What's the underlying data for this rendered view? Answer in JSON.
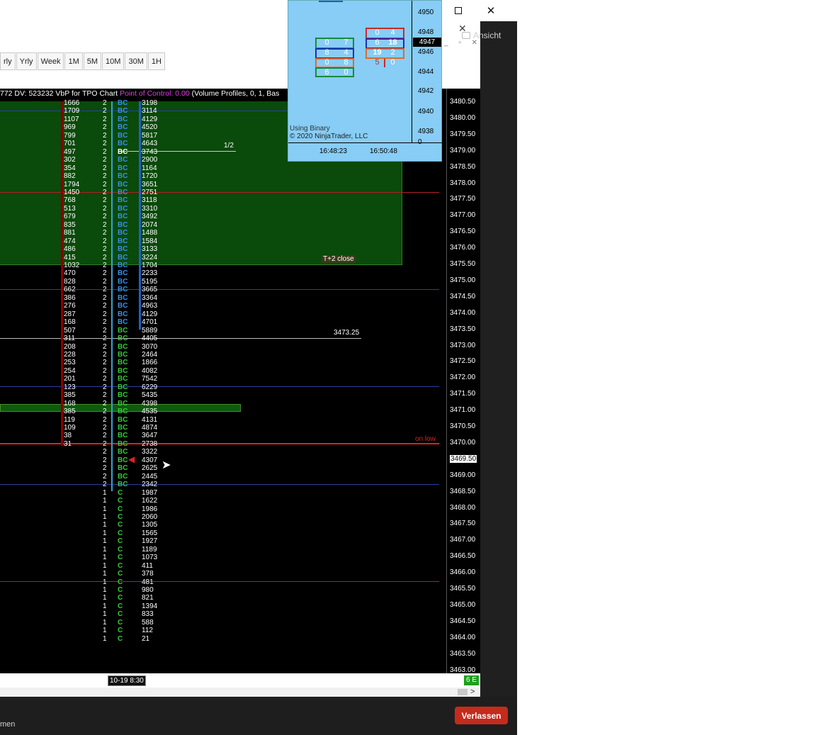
{
  "window": {
    "inner_close": "✕",
    "view_button": "Ansicht",
    "leave_button": "Verlassen",
    "meeting_text": "men"
  },
  "toolbar": {
    "timeframes": [
      "rly",
      "Yrly",
      "Week",
      "1M",
      "5M",
      "10M",
      "30M",
      "1H"
    ]
  },
  "chart": {
    "header_main": "772 DV: 523232 VbP for TPO Chart",
    "header_poc": "Point of Control: 0.00",
    "header_rest": "(Volume Profiles, 0, 1, Bas",
    "price_axis": [
      "3480.50",
      "3480.00",
      "3479.50",
      "3479.00",
      "3478.50",
      "3478.00",
      "3477.50",
      "3477.00",
      "3476.50",
      "3476.00",
      "3475.50",
      "3475.00",
      "3474.50",
      "3474.00",
      "3473.50",
      "3473.00",
      "3472.50",
      "3472.00",
      "3471.50",
      "3471.00",
      "3470.50",
      "3470.00",
      "3469.50",
      "3469.00",
      "3468.50",
      "3468.00",
      "3467.50",
      "3467.00",
      "3466.50",
      "3466.00",
      "3465.50",
      "3465.00",
      "3464.50",
      "3464.00",
      "3463.50",
      "3463.00"
    ],
    "current_price": "3469.50",
    "annotations": {
      "half": "1/2",
      "t2_close": "T+2 close",
      "level_3473": "3473.25",
      "on_low": "on low"
    },
    "date_label": "10-19  8:30",
    "status": "6 E",
    "rows": [
      {
        "vol": "1666",
        "cnt": "2",
        "let": "BC",
        "val": "3198",
        "color": "#3a8ee6"
      },
      {
        "vol": "1709",
        "cnt": "2",
        "let": "BC",
        "val": "3114",
        "color": "#3a8ee6"
      },
      {
        "vol": "1107",
        "cnt": "2",
        "let": "BC",
        "val": "4129",
        "color": "#3a8ee6"
      },
      {
        "vol": "969",
        "cnt": "2",
        "let": "BC",
        "val": "4520",
        "color": "#3a8ee6"
      },
      {
        "vol": "799",
        "cnt": "2",
        "let": "BC",
        "val": "5817",
        "color": "#3a8ee6"
      },
      {
        "vol": "701",
        "cnt": "2",
        "let": "BC",
        "val": "4643",
        "color": "#3a8ee6"
      },
      {
        "vol": "497",
        "cnt": "2",
        "let": "BC",
        "val": "3743",
        "color": "#ffffff"
      },
      {
        "vol": "302",
        "cnt": "2",
        "let": "BC",
        "val": "2900",
        "color": "#3a8ee6"
      },
      {
        "vol": "354",
        "cnt": "2",
        "let": "BC",
        "val": "1164",
        "color": "#3a8ee6"
      },
      {
        "vol": "882",
        "cnt": "2",
        "let": "BC",
        "val": "1720",
        "color": "#3a8ee6"
      },
      {
        "vol": "1794",
        "cnt": "2",
        "let": "BC",
        "val": "3651",
        "color": "#3a8ee6"
      },
      {
        "vol": "1450",
        "cnt": "2",
        "let": "BC",
        "val": "2751",
        "color": "#3a8ee6"
      },
      {
        "vol": "768",
        "cnt": "2",
        "let": "BC",
        "val": "3118",
        "color": "#3a8ee6"
      },
      {
        "vol": "513",
        "cnt": "2",
        "let": "BC",
        "val": "3310",
        "color": "#3a8ee6"
      },
      {
        "vol": "679",
        "cnt": "2",
        "let": "BC",
        "val": "3492",
        "color": "#3a8ee6"
      },
      {
        "vol": "835",
        "cnt": "2",
        "let": "BC",
        "val": "2074",
        "color": "#3a8ee6"
      },
      {
        "vol": "881",
        "cnt": "2",
        "let": "BC",
        "val": "1488",
        "color": "#3a8ee6"
      },
      {
        "vol": "474",
        "cnt": "2",
        "let": "BC",
        "val": "1584",
        "color": "#3a8ee6"
      },
      {
        "vol": "486",
        "cnt": "2",
        "let": "BC",
        "val": "3133",
        "color": "#3a8ee6"
      },
      {
        "vol": "415",
        "cnt": "2",
        "let": "BC",
        "val": "3224",
        "color": "#3a8ee6"
      },
      {
        "vol": "1032",
        "cnt": "2",
        "let": "BC",
        "val": "1704",
        "color": "#3a8ee6"
      },
      {
        "vol": "470",
        "cnt": "2",
        "let": "BC",
        "val": "2233",
        "color": "#3a8ee6"
      },
      {
        "vol": "828",
        "cnt": "2",
        "let": "BC",
        "val": "5195",
        "color": "#3a8ee6"
      },
      {
        "vol": "662",
        "cnt": "2",
        "let": "BC",
        "val": "3665",
        "color": "#3a8ee6"
      },
      {
        "vol": "386",
        "cnt": "2",
        "let": "BC",
        "val": "3364",
        "color": "#3a8ee6"
      },
      {
        "vol": "276",
        "cnt": "2",
        "let": "BC",
        "val": "4963",
        "color": "#3a8ee6"
      },
      {
        "vol": "287",
        "cnt": "2",
        "let": "BC",
        "val": "4129",
        "color": "#3a8ee6"
      },
      {
        "vol": "168",
        "cnt": "2",
        "let": "BC",
        "val": "4701",
        "color": "#3a8ee6"
      },
      {
        "vol": "507",
        "cnt": "2",
        "let": "BC",
        "val": "5889",
        "color": "#38c838"
      },
      {
        "vol": "311",
        "cnt": "2",
        "let": "BC",
        "val": "4405",
        "color": "#38c838"
      },
      {
        "vol": "208",
        "cnt": "2",
        "let": "BC",
        "val": "3070",
        "color": "#38c838"
      },
      {
        "vol": "228",
        "cnt": "2",
        "let": "BC",
        "val": "2464",
        "color": "#38c838"
      },
      {
        "vol": "253",
        "cnt": "2",
        "let": "BC",
        "val": "1866",
        "color": "#38c838"
      },
      {
        "vol": "254",
        "cnt": "2",
        "let": "BC",
        "val": "4082",
        "color": "#38c838"
      },
      {
        "vol": "201",
        "cnt": "2",
        "let": "BC",
        "val": "7542",
        "color": "#38c838"
      },
      {
        "vol": "123",
        "cnt": "2",
        "let": "BC",
        "val": "6229",
        "color": "#38c838"
      },
      {
        "vol": "385",
        "cnt": "2",
        "let": "BC",
        "val": "5435",
        "color": "#38c838"
      },
      {
        "vol": "168",
        "cnt": "2",
        "let": "BC",
        "val": "4398",
        "color": "#38c838"
      },
      {
        "vol": "385",
        "cnt": "2",
        "let": "BC",
        "val": "4535",
        "color": "#38c838"
      },
      {
        "vol": "119",
        "cnt": "2",
        "let": "BC",
        "val": "4131",
        "color": "#38c838"
      },
      {
        "vol": "109",
        "cnt": "2",
        "let": "BC",
        "val": "4874",
        "color": "#38c838"
      },
      {
        "vol": "38",
        "cnt": "2",
        "let": "BC",
        "val": "3647",
        "color": "#38c838"
      },
      {
        "vol": "31",
        "cnt": "2",
        "let": "BC",
        "val": "2738",
        "color": "#38c838"
      },
      {
        "vol": "",
        "cnt": "2",
        "let": "BC",
        "val": "3322",
        "color": "#38c838"
      },
      {
        "vol": "",
        "cnt": "2",
        "let": "BC",
        "val": "4307",
        "color": "#38c838"
      },
      {
        "vol": "",
        "cnt": "2",
        "let": "BC",
        "val": "2625",
        "color": "#38c838"
      },
      {
        "vol": "",
        "cnt": "2",
        "let": "BC",
        "val": "2445",
        "color": "#38c838"
      },
      {
        "vol": "",
        "cnt": "2",
        "let": "BC",
        "val": "2342",
        "color": "#38c838"
      },
      {
        "vol": "",
        "cnt": "1",
        "let": "C",
        "val": "1987",
        "color": "#38c838"
      },
      {
        "vol": "",
        "cnt": "1",
        "let": "C",
        "val": "1622",
        "color": "#38c838"
      },
      {
        "vol": "",
        "cnt": "1",
        "let": "C",
        "val": "1986",
        "color": "#38c838"
      },
      {
        "vol": "",
        "cnt": "1",
        "let": "C",
        "val": "2060",
        "color": "#38c838"
      },
      {
        "vol": "",
        "cnt": "1",
        "let": "C",
        "val": "1305",
        "color": "#38c838"
      },
      {
        "vol": "",
        "cnt": "1",
        "let": "C",
        "val": "1565",
        "color": "#38c838"
      },
      {
        "vol": "",
        "cnt": "1",
        "let": "C",
        "val": "1927",
        "color": "#38c838"
      },
      {
        "vol": "",
        "cnt": "1",
        "let": "C",
        "val": "1189",
        "color": "#38c838"
      },
      {
        "vol": "",
        "cnt": "1",
        "let": "C",
        "val": "1073",
        "color": "#38c838"
      },
      {
        "vol": "",
        "cnt": "1",
        "let": "C",
        "val": "411",
        "color": "#38c838"
      },
      {
        "vol": "",
        "cnt": "1",
        "let": "C",
        "val": "378",
        "color": "#38c838"
      },
      {
        "vol": "",
        "cnt": "1",
        "let": "C",
        "val": "481",
        "color": "#38c838"
      },
      {
        "vol": "",
        "cnt": "1",
        "let": "C",
        "val": "980",
        "color": "#38c838"
      },
      {
        "vol": "",
        "cnt": "1",
        "let": "C",
        "val": "821",
        "color": "#38c838"
      },
      {
        "vol": "",
        "cnt": "1",
        "let": "C",
        "val": "1394",
        "color": "#38c838"
      },
      {
        "vol": "",
        "cnt": "1",
        "let": "C",
        "val": "833",
        "color": "#38c838"
      },
      {
        "vol": "",
        "cnt": "1",
        "let": "C",
        "val": "588",
        "color": "#38c838"
      },
      {
        "vol": "",
        "cnt": "1",
        "let": "C",
        "val": "112",
        "color": "#38c838"
      },
      {
        "vol": "",
        "cnt": "1",
        "let": "C",
        "val": "21",
        "color": "#38c838"
      }
    ]
  },
  "ladder": {
    "axis": [
      "4950",
      "4948",
      "4946",
      "4944",
      "4942",
      "4940",
      "4938",
      "0"
    ],
    "current": "4947",
    "left_cells": [
      [
        "0",
        "7"
      ],
      [
        "8",
        "4"
      ],
      [
        "0",
        "8"
      ],
      [
        "6",
        "0"
      ]
    ],
    "right_cells": [
      [
        "0",
        "4"
      ],
      [
        "6",
        "18"
      ],
      [
        "19",
        "2"
      ],
      [
        "5",
        "0"
      ]
    ],
    "footer_line1": "Using Binary",
    "footer_line2": "© 2020 NinjaTrader, LLC",
    "times": [
      "16:48:23",
      "16:50:48"
    ]
  },
  "colors": {
    "accent_blue": "#3a8ee6",
    "accent_green": "#38c838",
    "poc_magenta": "#e040e0",
    "leave_red": "#c42b1c",
    "ladder_bg": "#87cdf5"
  }
}
